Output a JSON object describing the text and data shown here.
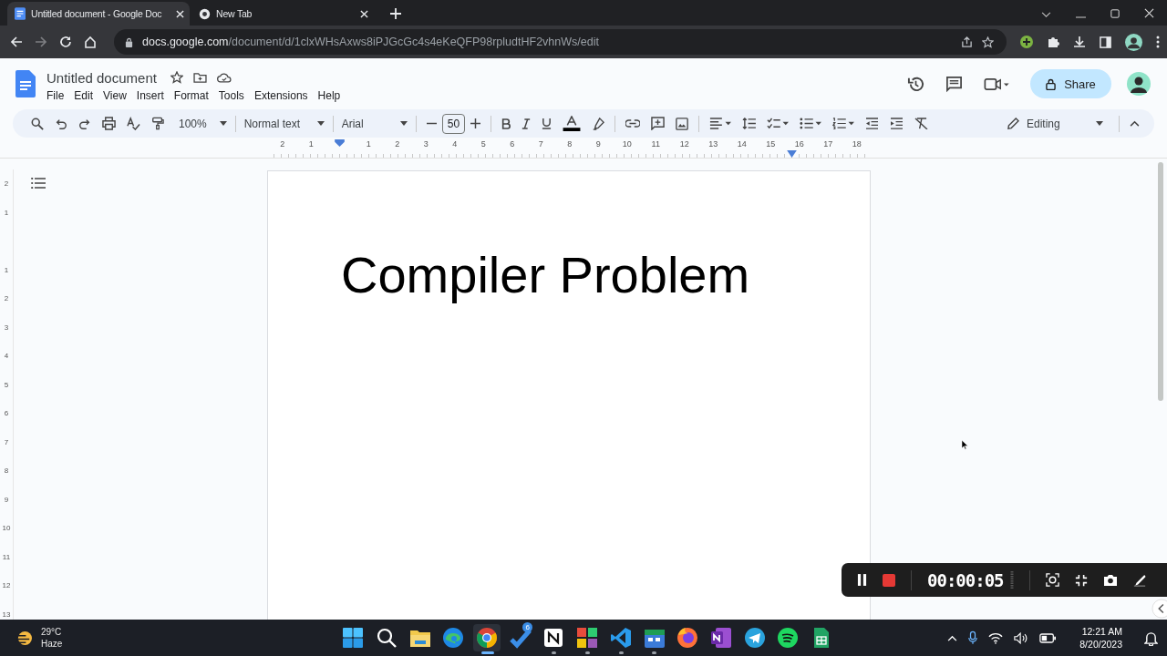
{
  "browser": {
    "tabs": [
      {
        "title": "Untitled document - Google Doc",
        "selected": true
      },
      {
        "title": "New Tab",
        "selected": false
      }
    ],
    "forward_disabled": true,
    "address": {
      "domain": "docs.google.com",
      "path": "/document/d/1clxWHsAxws8iPJGcGc4s4eKeQFP98rpludtHF2vhnWs/edit"
    }
  },
  "doc_header": {
    "title": "Untitled document",
    "menu": [
      "File",
      "Edit",
      "View",
      "Insert",
      "Format",
      "Tools",
      "Extensions",
      "Help"
    ],
    "share": "Share"
  },
  "toolbar": {
    "zoom": "100%",
    "style": "Normal text",
    "font": "Arial",
    "size": "50",
    "mode": "Editing"
  },
  "ruler": {
    "labels": [
      "2",
      "1",
      "1",
      "2",
      "3",
      "4",
      "5",
      "6",
      "7",
      "8",
      "9",
      "10",
      "11",
      "12",
      "13",
      "14",
      "15",
      "16",
      "17",
      "18"
    ]
  },
  "vertical_ruler": {
    "labels": [
      "2",
      "1",
      "1",
      "2",
      "3",
      "4",
      "5",
      "6",
      "7",
      "8",
      "9",
      "10",
      "11",
      "12",
      "13"
    ]
  },
  "document": {
    "heading": "Compiler Problem"
  },
  "recorder": {
    "time": "00:00:05"
  },
  "taskbar": {
    "weather": {
      "temp": "29°C",
      "condition": "Haze"
    },
    "apps": [
      {
        "kind": "start",
        "running": false,
        "selected": false
      },
      {
        "kind": "search",
        "running": false,
        "selected": false
      },
      {
        "kind": "files",
        "running": false,
        "selected": false
      },
      {
        "kind": "edge",
        "running": false,
        "selected": false
      },
      {
        "kind": "chrome",
        "running": true,
        "selected": true
      },
      {
        "kind": "check",
        "running": false,
        "selected": false,
        "badge": "6"
      },
      {
        "kind": "notion",
        "running": true,
        "selected": false
      },
      {
        "kind": "tiles",
        "running": true,
        "selected": false
      },
      {
        "kind": "vscode",
        "running": true,
        "selected": false
      },
      {
        "kind": "calendar",
        "running": true,
        "selected": false
      },
      {
        "kind": "firefox",
        "running": false,
        "selected": false
      },
      {
        "kind": "onenote",
        "running": false,
        "selected": false
      },
      {
        "kind": "telegram",
        "running": false,
        "selected": false
      },
      {
        "kind": "spotify",
        "running": false,
        "selected": false
      },
      {
        "kind": "sheets",
        "running": false,
        "selected": false
      }
    ],
    "clock": {
      "time": "12:21 AM",
      "date": "8/20/2023"
    }
  }
}
